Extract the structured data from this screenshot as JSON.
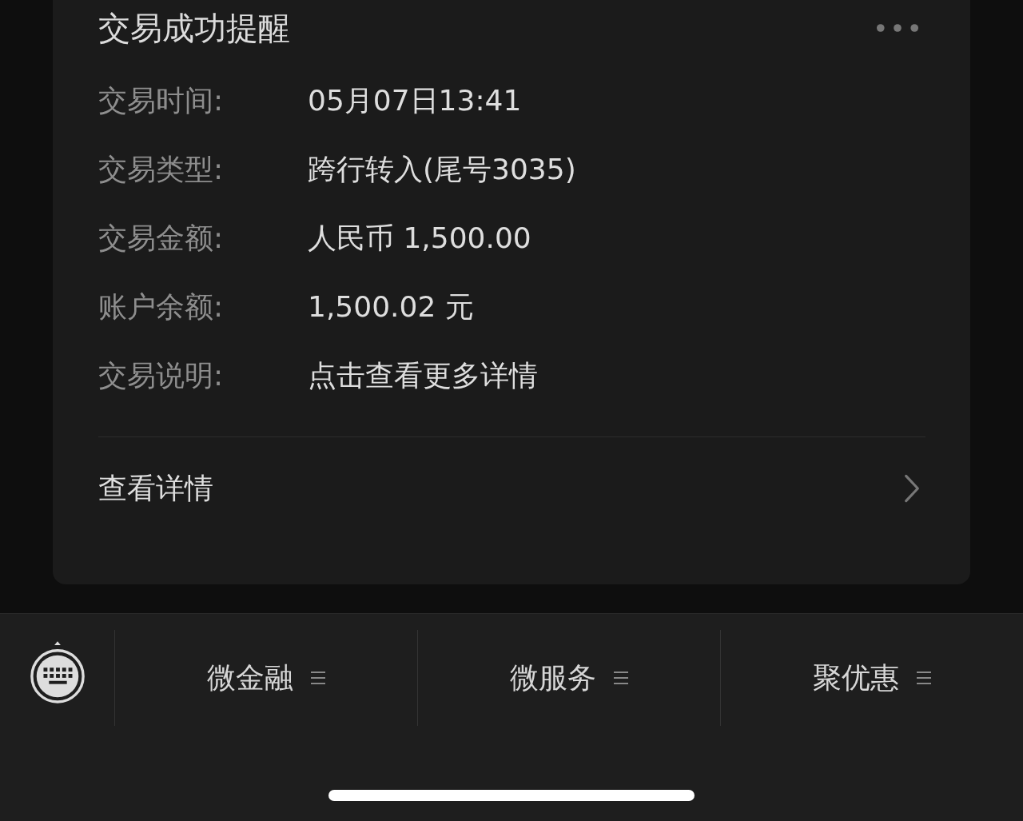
{
  "card": {
    "title": "交易成功提醒",
    "fields": [
      {
        "label": "交易时间:",
        "value": "05月07日13:41"
      },
      {
        "label": "交易类型:",
        "value": "跨行转入(尾号3035)"
      },
      {
        "label": "交易金额:",
        "value": "人民币 1,500.00"
      },
      {
        "label": "账户余额:",
        "value": "1,500.02 元"
      },
      {
        "label": "交易说明:",
        "value": "点击查看更多详情"
      }
    ],
    "link": "查看详情"
  },
  "menu_bar": {
    "items": [
      {
        "label": "微金融"
      },
      {
        "label": "微服务"
      },
      {
        "label": "聚优惠"
      }
    ]
  }
}
